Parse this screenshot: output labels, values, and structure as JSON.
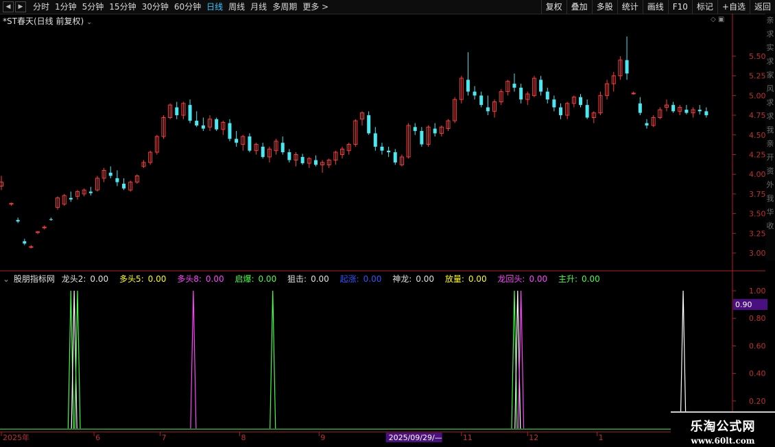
{
  "toolbar": {
    "nav": [
      "◀",
      "▶"
    ],
    "periods": [
      {
        "label": "分时",
        "active": false
      },
      {
        "label": "1分钟",
        "active": false
      },
      {
        "label": "5分钟",
        "active": false
      },
      {
        "label": "15分钟",
        "active": false
      },
      {
        "label": "30分钟",
        "active": false
      },
      {
        "label": "60分钟",
        "active": false
      },
      {
        "label": "日线",
        "active": true
      },
      {
        "label": "周线",
        "active": false
      },
      {
        "label": "月线",
        "active": false
      },
      {
        "label": "多周期",
        "active": false
      },
      {
        "label": "更多 >",
        "active": false
      }
    ],
    "buttons": [
      "复权",
      "叠加",
      "多股",
      "统计",
      "画线",
      "F10",
      "标记",
      "+自选",
      "返回"
    ]
  },
  "main_title": "*ST春天(日线 前复权)",
  "main_title_dropdown": "⌄",
  "indicator": {
    "name": "股朋指标网",
    "items": [
      {
        "label": "龙头2:",
        "value": "0.00",
        "color": "#e0e0e0"
      },
      {
        "label": "多头5:",
        "value": "0.00",
        "color": "#ffff00"
      },
      {
        "label": "多头8:",
        "value": "0.00",
        "color": "#ff44ff"
      },
      {
        "label": "启爆:",
        "value": "0.00",
        "color": "#44ff44"
      },
      {
        "label": "狙击:",
        "value": "0.00",
        "color": "#e0e0e0"
      },
      {
        "label": "起涨:",
        "value": "0.00",
        "color": "#3355ff"
      },
      {
        "label": "神龙:",
        "value": "0.00",
        "color": "#e0e0e0"
      },
      {
        "label": "放量:",
        "value": "0.00",
        "color": "#ffff00"
      },
      {
        "label": "龙回头:",
        "value": "0.00",
        "color": "#ff44ff"
      },
      {
        "label": "主升:",
        "value": "0.00",
        "color": "#44ff44"
      }
    ]
  },
  "right_strip_chars": [
    "亲",
    "求",
    "实",
    "求",
    "家",
    "风",
    "求",
    "求",
    "我",
    "亲",
    "开",
    "资",
    "外",
    "我",
    "华",
    "收"
  ],
  "watermark": {
    "line1": "乐淘公式网",
    "line2": "www.60lt.com"
  },
  "colors": {
    "up": "#ff3b3b",
    "down": "#4ae8f0",
    "axis": "#b02020"
  },
  "chart_data": [
    {
      "type": "candlestick",
      "title": "*ST春天(日线 前复权)",
      "y_ticks": [
        3.0,
        3.25,
        3.5,
        3.75,
        4.0,
        4.25,
        4.5,
        4.75,
        5.0,
        5.25,
        5.5
      ],
      "ylim": [
        2.8,
        5.9
      ],
      "x_tick_labels": [
        "2025年",
        "6",
        "7",
        "8",
        "9",
        "2025/09/29/—",
        "11",
        "12",
        "1"
      ],
      "x_tick_days": [
        0,
        28,
        48,
        72,
        96,
        117,
        139,
        159,
        180
      ],
      "x_range": [
        0,
        218
      ],
      "highlight_label": "2025/09/29/—",
      "candles": [
        [
          0,
          3.85,
          3.98,
          3.8,
          3.9
        ],
        [
          3,
          3.62,
          3.64,
          3.6,
          3.63
        ],
        [
          5,
          3.42,
          3.45,
          3.38,
          3.4
        ],
        [
          7,
          3.15,
          3.18,
          3.1,
          3.12
        ],
        [
          9,
          3.08,
          3.1,
          3.06,
          3.08
        ],
        [
          11,
          3.26,
          3.28,
          3.24,
          3.27
        ],
        [
          13,
          3.32,
          3.35,
          3.3,
          3.33
        ],
        [
          15,
          3.43,
          3.45,
          3.41,
          3.42
        ],
        [
          17,
          3.58,
          3.72,
          3.55,
          3.7
        ],
        [
          19,
          3.62,
          3.75,
          3.6,
          3.73
        ],
        [
          21,
          3.7,
          3.78,
          3.65,
          3.68
        ],
        [
          23,
          3.72,
          3.8,
          3.68,
          3.78
        ],
        [
          25,
          3.75,
          3.82,
          3.72,
          3.8
        ],
        [
          27,
          3.78,
          3.84,
          3.73,
          3.76
        ],
        [
          29,
          3.8,
          3.98,
          3.78,
          3.95
        ],
        [
          31,
          3.95,
          4.08,
          3.9,
          4.05
        ],
        [
          33,
          4.02,
          4.1,
          3.95,
          3.98
        ],
        [
          35,
          3.95,
          4.05,
          3.85,
          3.9
        ],
        [
          37,
          3.88,
          3.95,
          3.8,
          3.82
        ],
        [
          39,
          3.8,
          3.92,
          3.78,
          3.9
        ],
        [
          41,
          3.9,
          4.0,
          3.88,
          3.98
        ],
        [
          43,
          4.1,
          4.18,
          4.08,
          4.15
        ],
        [
          45,
          4.15,
          4.3,
          4.12,
          4.28
        ],
        [
          47,
          4.28,
          4.5,
          4.25,
          4.48
        ],
        [
          49,
          4.48,
          4.75,
          4.45,
          4.72
        ],
        [
          51,
          4.72,
          4.9,
          4.7,
          4.88
        ],
        [
          53,
          4.85,
          4.92,
          4.7,
          4.75
        ],
        [
          55,
          4.75,
          4.92,
          4.7,
          4.9
        ],
        [
          57,
          4.88,
          4.95,
          4.65,
          4.68
        ],
        [
          59,
          4.68,
          4.8,
          4.6,
          4.62
        ],
        [
          61,
          4.62,
          4.72,
          4.55,
          4.58
        ],
        [
          63,
          4.6,
          4.75,
          4.55,
          4.7
        ],
        [
          65,
          4.7,
          4.72,
          4.55,
          4.57
        ],
        [
          67,
          4.57,
          4.68,
          4.5,
          4.66
        ],
        [
          69,
          4.65,
          4.7,
          4.42,
          4.45
        ],
        [
          71,
          4.45,
          4.55,
          4.35,
          4.4
        ],
        [
          73,
          4.38,
          4.5,
          4.3,
          4.48
        ],
        [
          75,
          4.48,
          4.52,
          4.28,
          4.3
        ],
        [
          77,
          4.3,
          4.4,
          4.25,
          4.38
        ],
        [
          79,
          4.35,
          4.4,
          4.2,
          4.22
        ],
        [
          81,
          4.22,
          4.35,
          4.15,
          4.32
        ],
        [
          83,
          4.3,
          4.45,
          4.25,
          4.42
        ],
        [
          85,
          4.4,
          4.48,
          4.25,
          4.28
        ],
        [
          87,
          4.28,
          4.32,
          4.15,
          4.18
        ],
        [
          89,
          4.18,
          4.28,
          4.1,
          4.25
        ],
        [
          91,
          4.22,
          4.26,
          4.12,
          4.14
        ],
        [
          93,
          4.14,
          4.22,
          4.08,
          4.2
        ],
        [
          95,
          4.18,
          4.24,
          4.1,
          4.12
        ],
        [
          97,
          4.12,
          4.18,
          4.02,
          4.15
        ],
        [
          99,
          4.12,
          4.2,
          4.08,
          4.18
        ],
        [
          101,
          4.18,
          4.3,
          4.12,
          4.28
        ],
        [
          103,
          4.25,
          4.35,
          4.2,
          4.32
        ],
        [
          105,
          4.3,
          4.4,
          4.25,
          4.38
        ],
        [
          107,
          4.38,
          4.7,
          4.35,
          4.68
        ],
        [
          109,
          4.7,
          4.8,
          4.62,
          4.78
        ],
        [
          111,
          4.75,
          4.8,
          4.5,
          4.52
        ],
        [
          113,
          4.52,
          4.6,
          4.3,
          4.35
        ],
        [
          115,
          4.35,
          4.4,
          4.25,
          4.3
        ],
        [
          117,
          4.3,
          4.35,
          4.22,
          4.28
        ],
        [
          119,
          4.28,
          4.32,
          4.12,
          4.15
        ],
        [
          121,
          4.12,
          4.25,
          4.1,
          4.22
        ],
        [
          123,
          4.22,
          4.65,
          4.2,
          4.62
        ],
        [
          125,
          4.6,
          4.65,
          4.5,
          4.55
        ],
        [
          127,
          4.55,
          4.6,
          4.35,
          4.38
        ],
        [
          129,
          4.38,
          4.62,
          4.35,
          4.6
        ],
        [
          131,
          4.58,
          4.65,
          4.48,
          4.52
        ],
        [
          133,
          4.52,
          4.62,
          4.48,
          4.6
        ],
        [
          135,
          4.58,
          4.7,
          4.55,
          4.68
        ],
        [
          137,
          4.68,
          4.98,
          4.65,
          4.95
        ],
        [
          139,
          4.95,
          5.25,
          4.9,
          5.22
        ],
        [
          141,
          5.2,
          5.55,
          5.0,
          5.05
        ],
        [
          143,
          5.05,
          5.12,
          4.95,
          5.0
        ],
        [
          145,
          5.0,
          5.05,
          4.85,
          4.88
        ],
        [
          147,
          4.85,
          5.0,
          4.75,
          4.8
        ],
        [
          149,
          4.8,
          4.95,
          4.72,
          4.92
        ],
        [
          151,
          4.92,
          5.08,
          4.88,
          5.05
        ],
        [
          153,
          5.05,
          5.2,
          5.0,
          5.18
        ],
        [
          155,
          5.15,
          5.28,
          5.05,
          5.1
        ],
        [
          157,
          5.1,
          5.15,
          4.9,
          4.95
        ],
        [
          159,
          4.95,
          5.05,
          4.88,
          5.02
        ],
        [
          161,
          5.0,
          5.25,
          4.98,
          5.22
        ],
        [
          163,
          5.2,
          5.25,
          5.0,
          5.05
        ],
        [
          165,
          5.05,
          5.1,
          4.9,
          4.95
        ],
        [
          167,
          4.95,
          5.0,
          4.8,
          4.85
        ],
        [
          169,
          4.85,
          4.9,
          4.7,
          4.75
        ],
        [
          171,
          4.75,
          4.92,
          4.7,
          4.9
        ],
        [
          173,
          4.9,
          5.0,
          4.85,
          4.98
        ],
        [
          175,
          4.98,
          5.02,
          4.85,
          4.88
        ],
        [
          177,
          4.88,
          4.95,
          4.7,
          4.72
        ],
        [
          179,
          4.72,
          4.8,
          4.65,
          4.78
        ],
        [
          181,
          4.78,
          5.05,
          4.75,
          5.0
        ],
        [
          183,
          5.0,
          5.2,
          4.95,
          5.15
        ],
        [
          185,
          5.15,
          5.3,
          5.05,
          5.25
        ],
        [
          187,
          5.25,
          5.5,
          5.2,
          5.45
        ],
        [
          189,
          5.45,
          5.75,
          5.2,
          5.28
        ],
        [
          191,
          5.03,
          5.05,
          5.01,
          5.03
        ],
        [
          193,
          4.9,
          4.98,
          4.75,
          4.78
        ],
        [
          195,
          4.65,
          4.7,
          4.58,
          4.62
        ],
        [
          197,
          4.62,
          4.75,
          4.6,
          4.72
        ],
        [
          199,
          4.72,
          4.85,
          4.7,
          4.82
        ],
        [
          201,
          4.85,
          4.95,
          4.8,
          4.88
        ],
        [
          203,
          4.88,
          4.92,
          4.78,
          4.8
        ],
        [
          205,
          4.8,
          4.88,
          4.75,
          4.85
        ],
        [
          207,
          4.82,
          4.88,
          4.76,
          4.78
        ],
        [
          209,
          4.78,
          4.85,
          4.72,
          4.82
        ],
        [
          211,
          4.82,
          4.88,
          4.76,
          4.8
        ],
        [
          213,
          4.8,
          4.85,
          4.72,
          4.75
        ]
      ]
    },
    {
      "type": "line",
      "y_ticks": [
        0.2,
        0.4,
        0.6,
        0.8,
        1.0
      ],
      "ylim": [
        0,
        1.05
      ],
      "value_label": "0.90",
      "spikes": [
        {
          "day": 21,
          "value": 1.0,
          "color": "#44ff44"
        },
        {
          "day": 22,
          "value": 1.0,
          "color": "#ffffff"
        },
        {
          "day": 23,
          "value": 1.0,
          "color": "#44ff44"
        },
        {
          "day": 58,
          "value": 1.0,
          "color": "#ff44ff"
        },
        {
          "day": 82,
          "value": 1.0,
          "color": "#44ff44"
        },
        {
          "day": 155,
          "value": 1.0,
          "color": "#44ff44"
        },
        {
          "day": 156,
          "value": 1.0,
          "color": "#ffffff"
        },
        {
          "day": 157,
          "value": 1.0,
          "color": "#ff44ff"
        },
        {
          "day": 206,
          "value": 1.0,
          "color": "#ffffff"
        }
      ]
    }
  ]
}
